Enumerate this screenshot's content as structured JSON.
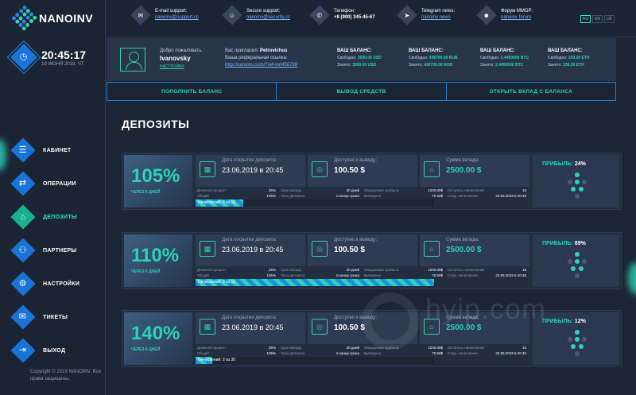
{
  "brand": {
    "name": "NANOINV"
  },
  "clock": {
    "time": "20:45:17",
    "date": "19 ИЮНЯ 2019, ЧТ"
  },
  "sidebar": {
    "items": [
      {
        "label": "КАБИНЕТ",
        "icon": "cabinet-icon",
        "glyph": "☰"
      },
      {
        "label": "ОПЕРАЦИИ",
        "icon": "operations-icon",
        "glyph": "⇄"
      },
      {
        "label": "ДЕПОЗИТЫ",
        "icon": "deposits-icon",
        "glyph": "⌂"
      },
      {
        "label": "ПАРТНЕРЫ",
        "icon": "partners-icon",
        "glyph": "⚇"
      },
      {
        "label": "НАСТРОЙКИ",
        "icon": "settings-icon",
        "glyph": "⚙"
      },
      {
        "label": "ТИКЕТЫ",
        "icon": "tickets-icon",
        "glyph": "✉"
      },
      {
        "label": "ВЫХОД",
        "icon": "logout-icon",
        "glyph": "⇥"
      }
    ],
    "active": "ДЕПОЗИТЫ",
    "copyright": "Copyright © 2019 NANOINV. Все права защищены."
  },
  "topbar": {
    "email": {
      "label": "E-mail support:",
      "value": "nanoinv@support.cc"
    },
    "secure": {
      "label": "Secure support:",
      "value": "nanoinv@security.cc"
    },
    "phone": {
      "label": "Телефон:",
      "value": "+8 (900) 345-45-67"
    },
    "telegram": {
      "label": "Telegram news:",
      "value": "nanoinv news"
    },
    "forum": {
      "label": "Форум MMGP:",
      "value": "nanoinv forum"
    },
    "langs": [
      "RU",
      "EN",
      "UK"
    ],
    "active_lang": "RU"
  },
  "user": {
    "welcome": "Добро пожаловать,",
    "name": "Ivanovsky",
    "settings_link": "НАСТРОЙКИ",
    "invited_label": "Вас пригласил:",
    "invited_by": "Petrovichus",
    "ref_label": "Ваша реферальная ссылка:",
    "ref_link": "http://nanoinv.com/?ref=ref456789"
  },
  "balances": [
    {
      "title": "ВАШ БАЛАНС:",
      "free_label": "Свободно:",
      "free": "3500.00 USD",
      "busy_label": "Занято:",
      "busy": "3500.00 USD"
    },
    {
      "title": "ВАШ БАЛАНС:",
      "free_label": "Свободно:",
      "free": "436700.00 RUB",
      "busy_label": "Занято:",
      "busy": "436700.00 RUB"
    },
    {
      "title": "ВАШ БАЛАНС:",
      "free_label": "Свободно:",
      "free": "2.4490000 BTC",
      "busy_label": "Занято:",
      "busy": "2.4490000 BTC"
    },
    {
      "title": "ВАШ БАЛАНС:",
      "free_label": "Свободно:",
      "free": "239.39 ETH",
      "busy_label": "Занято:",
      "busy": "239.39 ETH"
    }
  ],
  "actions": [
    "ПОПОЛНИТЬ БАЛАНС",
    "ВЫВОД СРЕДСТВ",
    "ОТКРЫТЬ ВКЛАД С БАЛАНСА"
  ],
  "page_title": "ДЕПОЗИТЫ",
  "deposits": [
    {
      "percent": "105%",
      "sub": "ЧЕРЕЗ 6 ДНЕЙ",
      "open_label": "Дата открытия депозита:",
      "open_date": "23.06.2019 в 20:45",
      "avail_label": "Доступно к выводу:",
      "avail": "100.50 $",
      "sum_label": "Сумма вклада:",
      "sum": "2500.00 $",
      "daily_label": "Дневной процент",
      "daily": "25%",
      "total_label": "Общий",
      "total": "105%",
      "term_label": "Срок вклада",
      "term": "20 дней",
      "body_label": "Тело депозита",
      "body": "в конце срока",
      "expected_label": "Ожидаемая прибыль",
      "expected": "1200.00$",
      "paid_label": "Выведено",
      "paid": "70.50$",
      "left_label": "Осталось начислений",
      "left": "15",
      "next_label": "След. начисление",
      "next": "23.06.2019 в 20:45",
      "progress_text": "Начислений: 3 из 15",
      "progress": 0.2,
      "profit_label": "ПРИБЫЛЬ:",
      "profit": "24%"
    },
    {
      "percent": "110%",
      "sub": "ЧЕРЕЗ 6 ДНЕЙ",
      "open_label": "Дата открытия депозита:",
      "open_date": "23.06.2019 в 20:45",
      "avail_label": "Доступно к выводу:",
      "avail": "100.50 $",
      "sum_label": "Сумма вклада:",
      "sum": "2500.00 $",
      "daily_label": "Дневной процент",
      "daily": "25%",
      "total_label": "Общий",
      "total": "105%",
      "term_label": "Срок вклада",
      "term": "20 дней",
      "body_label": "Тело депозита",
      "body": "в конце срока",
      "expected_label": "Ожидаемая прибыль",
      "expected": "1200.00$",
      "paid_label": "Выведено",
      "paid": "70.50$",
      "left_label": "Осталось начислений",
      "left": "15",
      "next_label": "След. начисление",
      "next": "23.06.2019 в 20:45",
      "progress_text": "Начислений: 3 из 15",
      "progress": 1.0,
      "profit_label": "ПРИБЫЛЬ:",
      "profit": "89%"
    },
    {
      "percent": "140%",
      "sub": "ЧЕРЕЗ 6 ДНЕЙ",
      "open_label": "Дата открытия депозита:",
      "open_date": "23.06.2019 в 20:45",
      "avail_label": "Доступно к выводу:",
      "avail": "100.50 $",
      "sum_label": "Сумма вклада:",
      "sum": "2500.00 $",
      "daily_label": "Дневной процент",
      "daily": "25%",
      "total_label": "Общий",
      "total": "105%",
      "term_label": "Срок вклада",
      "term": "20 дней",
      "body_label": "Тело депозита",
      "body": "в конце срока",
      "expected_label": "Ожидаемая прибыль",
      "expected": "1200.00$",
      "paid_label": "Выведено",
      "paid": "70.50$",
      "left_label": "Осталось начислений",
      "left": "15",
      "next_label": "След. начисление",
      "next": "23.06.2019 в 20:45",
      "progress_text": "Начислений: 2 из 30",
      "progress": 0.07,
      "profit_label": "ПРИБЫЛЬ:",
      "profit": "12%"
    }
  ],
  "watermark": "hyip.com",
  "colors": {
    "accent": "#2bd3b8",
    "primary": "#1a74d8",
    "bg": "#1c2534"
  }
}
